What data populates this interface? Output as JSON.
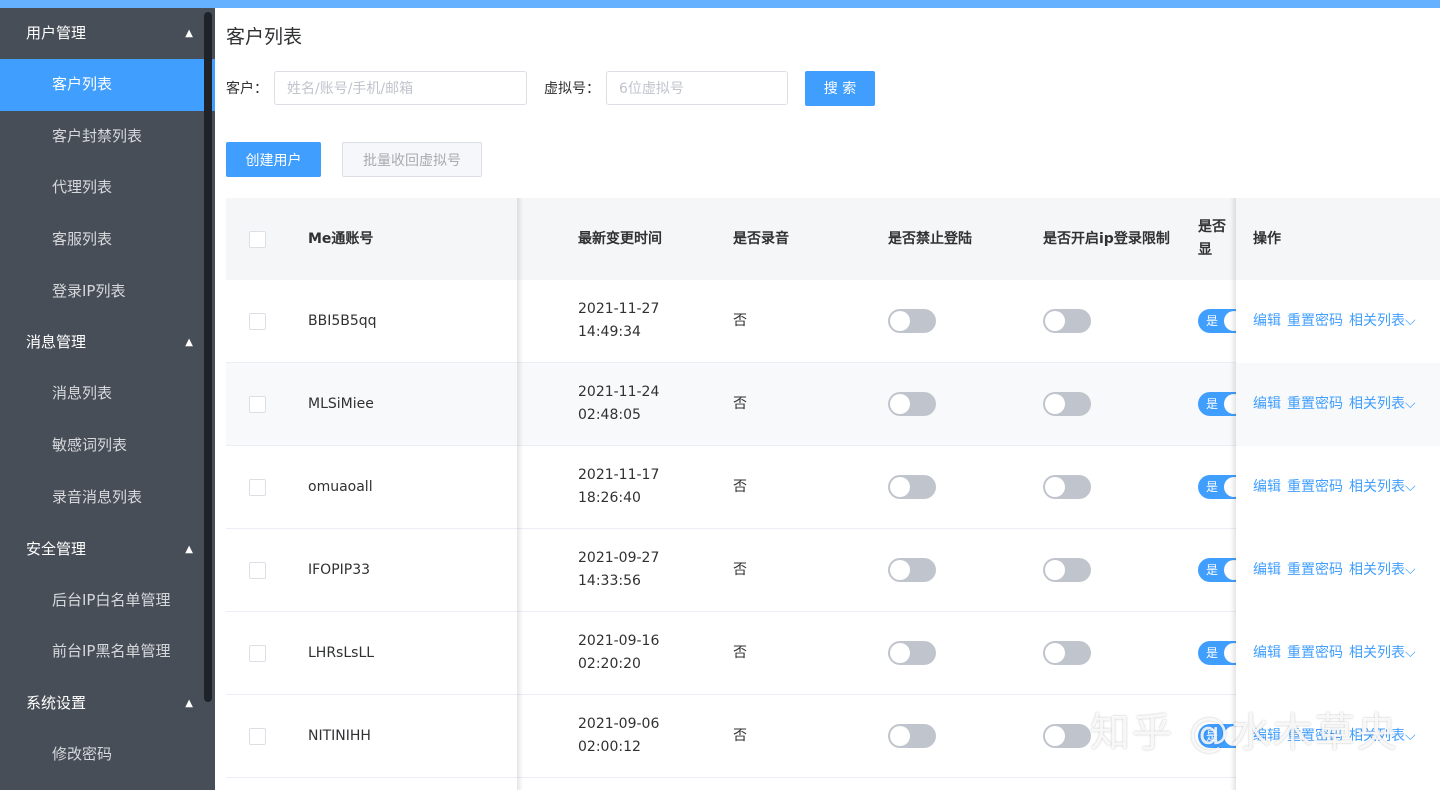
{
  "sidebar": {
    "groups": [
      {
        "title": "用户管理",
        "items": [
          "客户列表",
          "客户封禁列表",
          "代理列表",
          "客服列表",
          "登录IP列表"
        ]
      },
      {
        "title": "消息管理",
        "items": [
          "消息列表",
          "敏感词列表",
          "录音消息列表"
        ]
      },
      {
        "title": "安全管理",
        "items": [
          "后台IP白名单管理",
          "前台IP黑名单管理"
        ]
      },
      {
        "title": "系统设置",
        "items": [
          "修改密码"
        ]
      }
    ],
    "active_item": "客户列表"
  },
  "page": {
    "title": "客户列表"
  },
  "search": {
    "customer_label": "客户：",
    "customer_placeholder": "姓名/账号/手机/邮箱",
    "virtual_label": "虚拟号：",
    "virtual_placeholder": "6位虚拟号",
    "search_button": "搜 索"
  },
  "actions": {
    "create_user": "创建用户",
    "batch_reclaim": "批量收回虚拟号"
  },
  "table": {
    "headers": {
      "account": "Me通账号",
      "updated": "最新变更时间",
      "recording": "是否录音",
      "login_banned": "是否禁止登陆",
      "ip_limit": "是否开启ip登录限制",
      "display": "是否显",
      "operation": "操作"
    },
    "rows": [
      {
        "account": "BBI5B5qq",
        "date": "2021-11-27",
        "time": "14:49:34",
        "recording": "否",
        "display_switch": "是"
      },
      {
        "account": "MLSiMiee",
        "date": "2021-11-24",
        "time": "02:48:05",
        "recording": "否",
        "display_switch": "是"
      },
      {
        "account": "omuaoall",
        "date": "2021-11-17",
        "time": "18:26:40",
        "recording": "否",
        "display_switch": "是"
      },
      {
        "account": "IFOPIP33",
        "date": "2021-09-27",
        "time": "14:33:56",
        "recording": "否",
        "display_switch": "是"
      },
      {
        "account": "LHRsLsLL",
        "date": "2021-09-16",
        "time": "02:20:20",
        "recording": "否",
        "display_switch": "是"
      },
      {
        "account": "NITINIHH",
        "date": "2021-09-06",
        "time": "02:00:12",
        "recording": "否",
        "display_switch": "是"
      }
    ],
    "op_links": {
      "edit": "编辑",
      "reset_password": "重置密码",
      "related": "相关列表"
    }
  },
  "watermark": "知乎 @水木草央",
  "colors": {
    "sidebar_bg": "#484e57",
    "accent": "#409eff",
    "topbar": "#66b1ff"
  }
}
